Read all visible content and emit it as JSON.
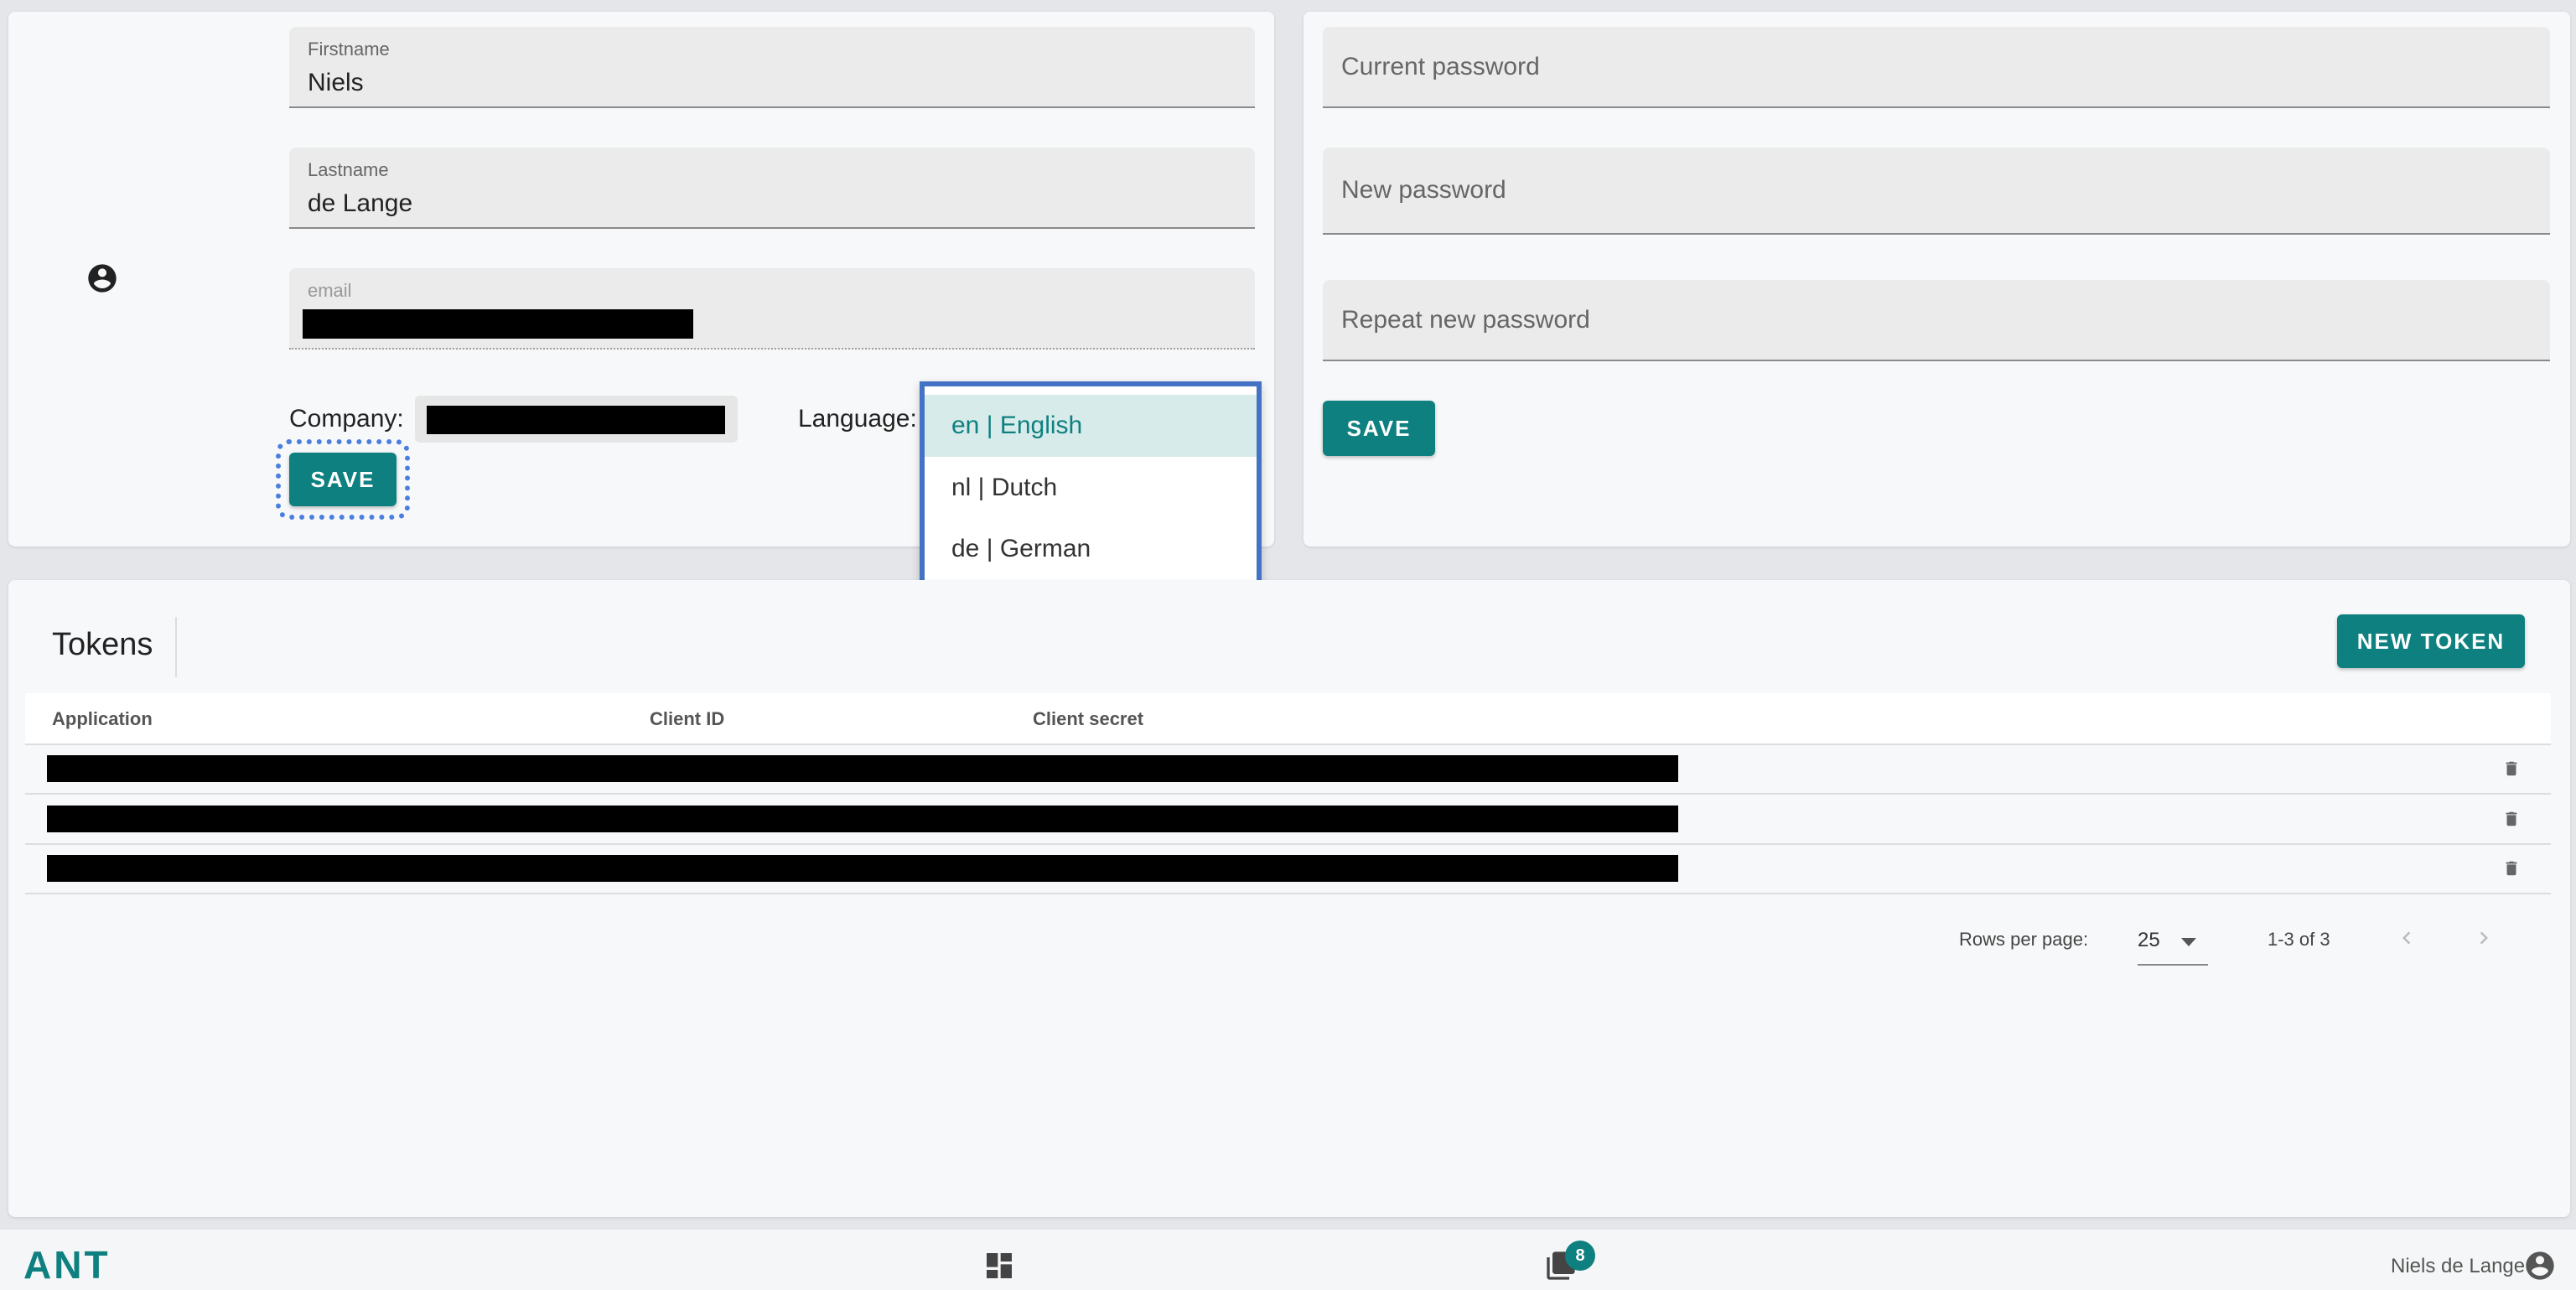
{
  "profile": {
    "firstname_label": "Firstname",
    "firstname_value": "Niels",
    "lastname_label": "Lastname",
    "lastname_value": "de Lange",
    "email_label": "email",
    "company_label": "Company:",
    "language_label": "Language:",
    "save_label": "SAVE",
    "avatar_icon": "account-circle-icon"
  },
  "language_dropdown": {
    "options": [
      "en | English",
      "nl | Dutch",
      "de | German"
    ],
    "selected": "en | English"
  },
  "password": {
    "current_placeholder": "Current password",
    "new_placeholder": "New password",
    "repeat_placeholder": "Repeat new password",
    "save_label": "SAVE"
  },
  "tokens": {
    "title": "Tokens",
    "new_token_label": "NEW TOKEN",
    "columns": [
      "Application",
      "Client ID",
      "Client secret"
    ],
    "rows_per_page_label": "Rows per page:",
    "rows_per_page_value": "25",
    "range_text": "1-3 of 3"
  },
  "footer": {
    "logo": "ANT",
    "badge_count": "8",
    "user_name": "Niels de Lange"
  },
  "colors": {
    "accent": "#0f8080",
    "focus": "#4472c4"
  }
}
